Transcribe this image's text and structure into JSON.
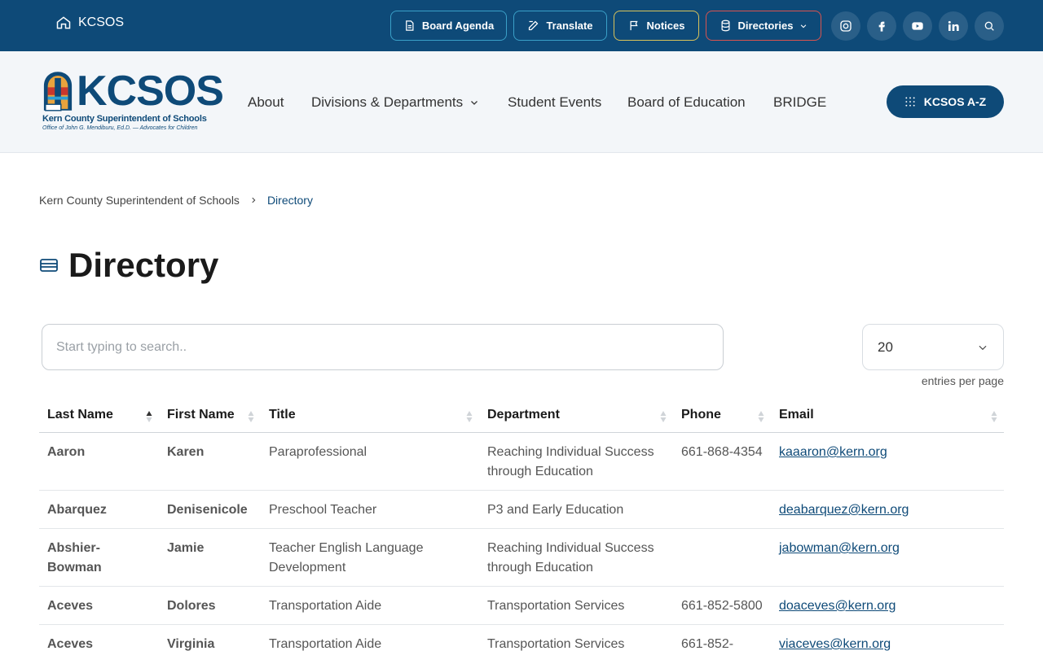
{
  "topbar": {
    "home_label": "KCSOS",
    "buttons": [
      {
        "label": "Board Agenda"
      },
      {
        "label": "Translate"
      },
      {
        "label": "Notices"
      },
      {
        "label": "Directories"
      }
    ],
    "social": [
      "instagram-icon",
      "facebook-icon",
      "youtube-icon",
      "linkedin-icon",
      "search-icon"
    ]
  },
  "header": {
    "logo_word": "KCSOS",
    "logo_line1": "Kern County Superintendent of Schools",
    "logo_line2": "Office of John G. Mendiburu, Ed.D. — Advocates for Children",
    "nav": [
      "About",
      "Divisions & Departments",
      "Student Events",
      "Board of Education",
      "BRIDGE"
    ],
    "az_label": "KCSOS A-Z"
  },
  "breadcrumb": {
    "parent": "Kern County Superintendent of Schools",
    "current": "Directory"
  },
  "page": {
    "title": "Directory",
    "search_placeholder": "Start typing to search..",
    "per_page": "20",
    "per_page_label": "entries per page"
  },
  "table": {
    "headers": [
      "Last Name",
      "First Name",
      "Title",
      "Department",
      "Phone",
      "Email"
    ],
    "rows": [
      {
        "last": "Aaron",
        "first": "Karen",
        "title": "Paraprofessional",
        "dept": "Reaching Individual Success through Education",
        "phone": "661-868-4354",
        "email": "kaaaron@kern.org"
      },
      {
        "last": "Abarquez",
        "first": "Denisenicole",
        "title": "Preschool Teacher",
        "dept": "P3 and Early Education",
        "phone": "",
        "email": "deabarquez@kern.org"
      },
      {
        "last": "Abshier-Bowman",
        "first": "Jamie",
        "title": "Teacher English Language Development",
        "dept": "Reaching Individual Success through Education",
        "phone": "",
        "email": "jabowman@kern.org"
      },
      {
        "last": "Aceves",
        "first": "Dolores",
        "title": "Transportation Aide",
        "dept": "Transportation Services",
        "phone": "661-852-5800",
        "email": "doaceves@kern.org"
      },
      {
        "last": "Aceves",
        "first": "Virginia",
        "title": "Transportation Aide",
        "dept": "Transportation Services",
        "phone": "661-852-",
        "email": "viaceves@kern.org"
      }
    ]
  },
  "colors": {
    "brand": "#0e4a78",
    "header_bg": "#f3f6f9"
  }
}
